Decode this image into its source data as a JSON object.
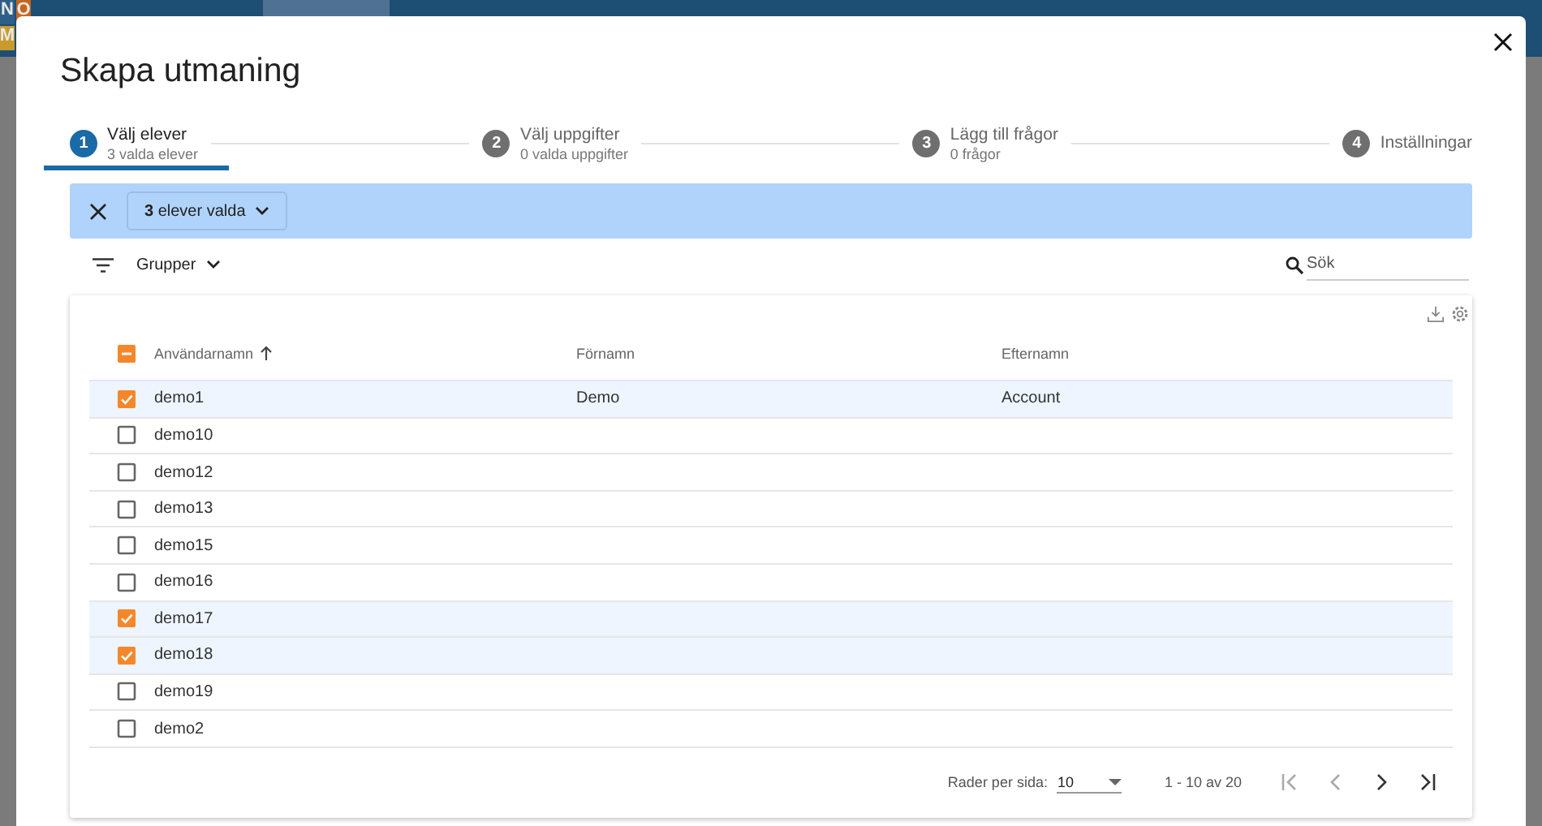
{
  "backdrop": {
    "logo_tiles": [
      {
        "text": "N",
        "color": "#2e5f88"
      },
      {
        "text": "O",
        "color": "#c7651f"
      },
      {
        "text": "M",
        "color": "#c99a2c"
      }
    ]
  },
  "dialog": {
    "title": "Skapa utmaning"
  },
  "steps": [
    {
      "number": "1",
      "label": "Välj elever",
      "sublabel": "3 valda elever",
      "selected": true
    },
    {
      "number": "2",
      "label": "Välj uppgifter",
      "sublabel": "0 valda uppgifter",
      "selected": false
    },
    {
      "number": "3",
      "label": "Lägg till frågor",
      "sublabel": "0 frågor",
      "selected": false
    },
    {
      "number": "4",
      "label": "Inställningar",
      "selected": false
    }
  ],
  "selection_bar": {
    "count_label": "**3** elever valda"
  },
  "toolbar": {
    "group_filter": "Grupper",
    "search": {
      "placeholder": "Sök"
    }
  },
  "table": {
    "select_all": {
      "indeterminate": true
    },
    "columns": [
      {
        "label": "Användarnamn",
        "sorted": true
      },
      {
        "label": "Förnamn",
        "sorted": false
      },
      {
        "label": "Efternamn",
        "sorted": false
      }
    ],
    "rows": [
      {
        "cells": [
          "demo1",
          "Demo",
          "Account"
        ],
        "selected": true
      },
      {
        "cells": [
          "demo10"
        ],
        "selected": false
      },
      {
        "cells": [
          "demo12"
        ],
        "selected": false
      },
      {
        "cells": [
          "demo13"
        ],
        "selected": false
      },
      {
        "cells": [
          "demo15"
        ],
        "selected": false
      },
      {
        "cells": [
          "demo16"
        ],
        "selected": false
      },
      {
        "cells": [
          "demo17"
        ],
        "selected": true
      },
      {
        "cells": [
          "demo18"
        ],
        "selected": true
      },
      {
        "cells": [
          "demo19"
        ],
        "selected": false
      },
      {
        "cells": [
          "demo2"
        ],
        "selected": false
      }
    ]
  },
  "pagination": {
    "rows_per_page_label": "Rader per sida:",
    "rows_per_page": "10",
    "range": "1 - 10 av 20",
    "nav": [
      {
        "kind": "first",
        "disabled": true
      },
      {
        "kind": "prev",
        "disabled": true
      },
      {
        "kind": "next",
        "disabled": false
      },
      {
        "kind": "last",
        "disabled": false
      }
    ]
  }
}
